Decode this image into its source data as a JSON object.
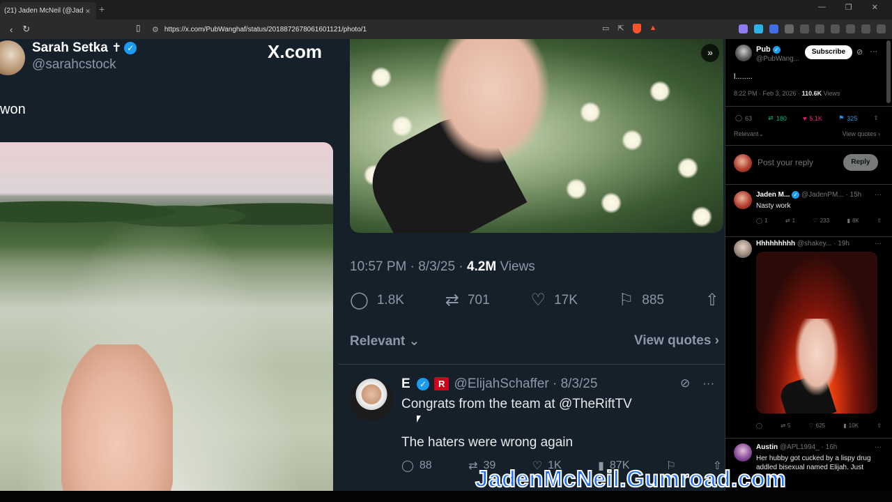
{
  "browser": {
    "tab_title": "(21) Jaden McNeil (@JadenPl...",
    "tab_close": "×",
    "new_tab": "+",
    "url": "https://x.com/PubWanghaf/status/2018872678061601121/photo/1",
    "brave_badge": "1"
  },
  "left_tweet": {
    "name": "Sarah Setka",
    "cross": "✝",
    "handle": "@sarahcstock",
    "site": "X.com",
    "text_fragment": "won"
  },
  "main_tweet": {
    "time": "10:57 PM",
    "date": "8/3/25",
    "views_count": "4.2M",
    "views_label": "Views",
    "replies": "1.8K",
    "reposts": "701",
    "likes": "17K",
    "bookmarks": "885",
    "sort_label": "Relevant",
    "view_quotes": "View quotes"
  },
  "reply_e": {
    "name": "E",
    "badge": "R",
    "handle": "@ElijahSchaffer",
    "date": "8/3/25",
    "line1": "Congrats from the team at @TheRiftTV",
    "line2": "The haters were wrong again",
    "replies": "88",
    "reposts": "39",
    "likes": "1K",
    "views": "87K"
  },
  "sidebar": {
    "pub_name": "Pub",
    "pub_handle": "@PubWang...",
    "subscribe": "Subscribe",
    "pub_text": "l........",
    "pub_time": "8:22 PM · Feb 3, 2026 · ",
    "pub_views": "110.6K",
    "pub_views_label": " Views",
    "replies": "63",
    "reposts": "180",
    "likes": "5.1K",
    "bookmarks": "325",
    "sort_label": "Relevant",
    "view_quotes": "View quotes",
    "reply_placeholder": "Post your reply",
    "reply_button": "Reply",
    "items": [
      {
        "name": "Jaden M...",
        "handle": "@JadenPM...",
        "time": "15h",
        "text": "Nasty work",
        "replies": "1",
        "reposts": "1",
        "likes": "233",
        "views": "8K"
      },
      {
        "name": "Hhhhhhhhh",
        "handle": "@shakey...",
        "time": "19h",
        "text": "",
        "replies": "",
        "reposts": "5",
        "likes": "625",
        "views": "10K"
      },
      {
        "name": "Austin",
        "handle": "@APL1994_",
        "time": "16h",
        "text": "Her hubby got cucked by a lispy drug addled bisexual named Elijah. Just",
        "replies": "",
        "reposts": "",
        "likes": "",
        "views": ""
      }
    ]
  },
  "watermark": "JadenMcNeil.Gumroad.com"
}
